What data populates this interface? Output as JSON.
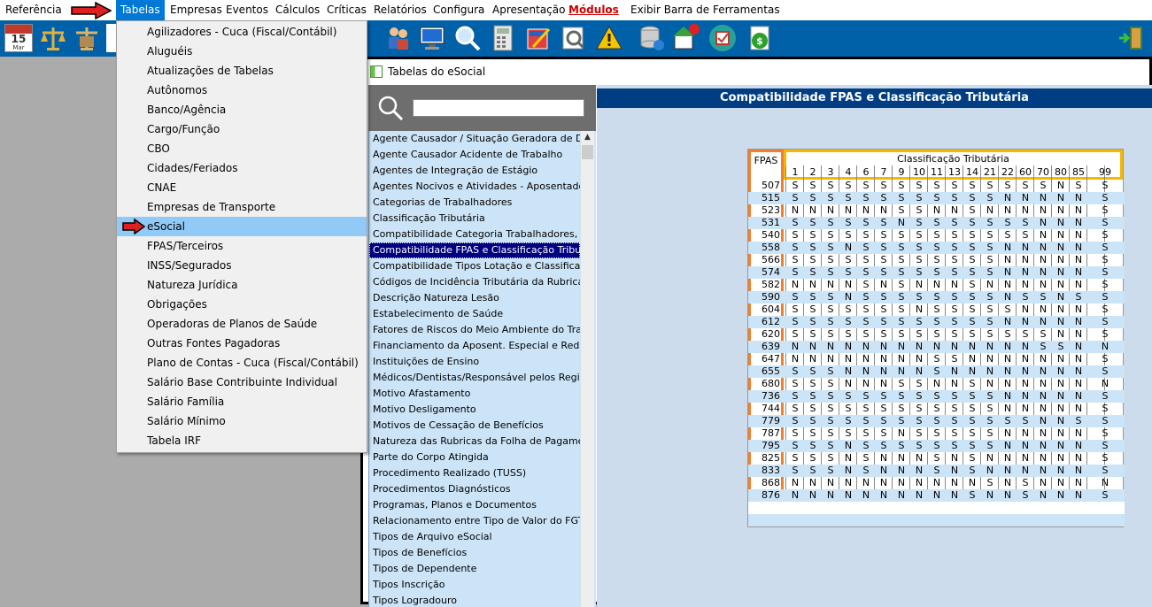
{
  "menu": [
    "Referência",
    "Tabelas",
    "Empresas",
    "Eventos",
    "Cálculos",
    "Críticas",
    "Relatórios",
    "Configura",
    "Apresentação",
    "Módulos",
    "Exibir Barra de Ferramentas"
  ],
  "calendar": {
    "day": "15",
    "month": "Mar"
  },
  "dropdown": [
    "Agilizadores - Cuca (Fiscal/Contábil)",
    "Aluguéis",
    "Atualizações de Tabelas",
    "Autônomos",
    "Banco/Agência",
    "Cargo/Função",
    "CBO",
    "Cidades/Feriados",
    "CNAE",
    "Empresas de Transporte",
    "eSocial",
    "FPAS/Terceiros",
    "INSS/Segurados",
    "Natureza Jurídica",
    "Obrigações",
    "Operadoras de Planos de Saúde",
    "Outras Fontes Pagadoras",
    "Plano de Contas - Cuca (Fiscal/Contábil)",
    "Salário Base Contribuinte Individual",
    "Salário Família",
    "Salário Mínimo",
    "Tabela IRF"
  ],
  "window": {
    "title": "Tabelas do eSocial",
    "search_value": ""
  },
  "table_list": [
    "Agente Causador / Situação Geradora de Doença",
    "Agente Causador Acidente de Trabalho",
    "Agentes de Integração de Estágio",
    "Agentes Nocivos e Atividades - Aposentadoria E",
    "Categorias de Trabalhadores",
    "Classificação Tributária",
    "Compatibilidade Categoria Trabalhadores, Classif",
    "Compatibilidade FPAS e Classificação Tributária",
    "Compatibilidade Tipos Lotação e Classificação Tri",
    "Códigos de Incidência Tributária da Rubrica para",
    "Descrição Natureza Lesão",
    "Estabelecimento de Saúde",
    "Fatores de Riscos do Meio Ambiente do Trabalho",
    "Financiamento da Aposent. Especial e Redução d",
    "Instituições de Ensino",
    "Médicos/Dentistas/Responsável pelos Registros",
    "Motivo Afastamento",
    "Motivo Desligamento",
    "Motivos de Cessação de Benefícios",
    "Natureza das Rubricas da Folha de Pagamento",
    "Parte do Corpo Atingida",
    "Procedimento Realizado (TUSS)",
    "Procedimentos Diagnósticos",
    "Programas, Planos e Documentos",
    "Relacionamento entre Tipo de Valor do FGTS, Ca",
    "Tipos de Arquivo eSocial",
    "Tipos de Benefícios",
    "Tipos de Dependente",
    "Tipos Inscrição",
    "Tipos Logradouro"
  ],
  "panel_title": "Compatibilidade FPAS e Classificação Tributária",
  "grid": {
    "fpas_header": "FPAS",
    "ct_header": "Classificação Tributária",
    "columns": [
      "1",
      "2",
      "3",
      "4",
      "6",
      "7",
      "9",
      "10",
      "11",
      "13",
      "14",
      "21",
      "22",
      "60",
      "70",
      "80",
      "85",
      "99"
    ],
    "rows": [
      {
        "fpas": "507",
        "v": "SSSSSSSSSSSSSSSNSS"
      },
      {
        "fpas": "515",
        "v": "SSSSSSSSSSSSNNNNNS"
      },
      {
        "fpas": "523",
        "v": "NNNNNNSSNNSNNNNNNS"
      },
      {
        "fpas": "531",
        "v": "SSSSSSNSSSSSSSNNNS"
      },
      {
        "fpas": "540",
        "v": "SSSSSSSSSSSSSSNNNS"
      },
      {
        "fpas": "558",
        "v": "SSSNSSSSSSSSNNNNNS"
      },
      {
        "fpas": "566",
        "v": "SSSSSSSSSSSSNNNNNS"
      },
      {
        "fpas": "574",
        "v": "SSSSSSSSSSSSNNNNNS"
      },
      {
        "fpas": "582",
        "v": "NNNNSNSNNNSNNNNNNS"
      },
      {
        "fpas": "590",
        "v": "SSSNSSSSSSSSNSSNSS"
      },
      {
        "fpas": "604",
        "v": "SSSSSSSNSSSSSNNNNS"
      },
      {
        "fpas": "612",
        "v": "SSSSSSSSSSSSNNNNNS"
      },
      {
        "fpas": "620",
        "v": "SSSSSSSSSSSSSSSNNS"
      },
      {
        "fpas": "639",
        "v": "NNNNNNNNNNNNNNSSNN"
      },
      {
        "fpas": "647",
        "v": "NNNNNNNNSSNNNNNNNS"
      },
      {
        "fpas": "655",
        "v": "SSSNNNNNSNNNNNNNNS"
      },
      {
        "fpas": "680",
        "v": "SSSNNNSSNNSNNNNNNN"
      },
      {
        "fpas": "736",
        "v": "SSSSSSSSSSSSNNNNNS"
      },
      {
        "fpas": "744",
        "v": "SSSSSSSSSSSSNNNNNS"
      },
      {
        "fpas": "779",
        "v": "SSSSSSSSSSSSSSNNSS"
      },
      {
        "fpas": "787",
        "v": "SSSSSSNSSSSSNNNNNS"
      },
      {
        "fpas": "795",
        "v": "SSSNSSSSSSSSNNNNNS"
      },
      {
        "fpas": "825",
        "v": "SSSNSNNNSNSNNNNNNS"
      },
      {
        "fpas": "833",
        "v": "SSSNSNNNSNSNNNNNNS"
      },
      {
        "fpas": "868",
        "v": "NNNNNNNNNNNSNSNNNN"
      },
      {
        "fpas": "876",
        "v": "NNNNNNNNNNSNNSNNNS"
      }
    ]
  }
}
